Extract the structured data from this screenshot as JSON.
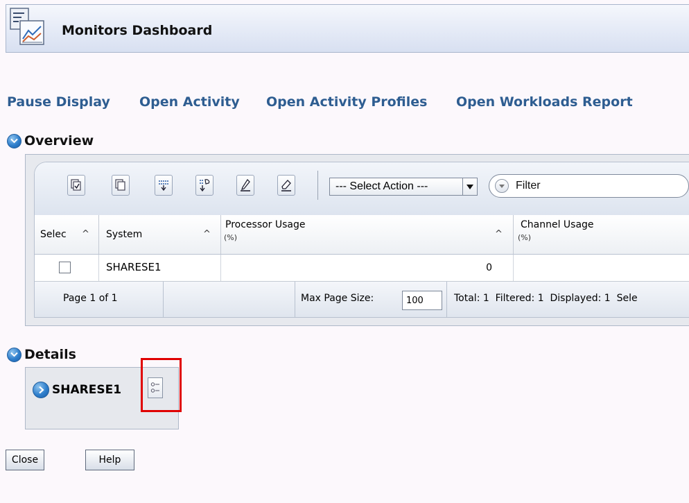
{
  "window": {
    "title": "Monitors Dashboard"
  },
  "links": {
    "pause_display": "Pause Display",
    "open_activity": "Open Activity",
    "open_activity_profiles": "Open Activity Profiles",
    "open_workloads_report": "Open Workloads Report"
  },
  "overview": {
    "title": "Overview",
    "toolbar": {
      "select_action": "--- Select Action ---",
      "filter_placeholder": "Filter"
    },
    "columns": {
      "select": {
        "label": "Selec",
        "sort": "^"
      },
      "system": {
        "label": "System",
        "sort": "^"
      },
      "processor": {
        "label": "Processor Usage",
        "unit": "(%)",
        "sort": "^"
      },
      "channel": {
        "label": "Channel Usage",
        "unit": "(%)"
      }
    },
    "rows": [
      {
        "system": "SHARESE1",
        "processor_usage": "0",
        "channel_usage": ""
      }
    ],
    "pager": {
      "page_info": "Page 1 of 1",
      "max_page_size_label": "Max Page Size:",
      "max_page_size_value": "100",
      "summary": "Total: 1  Filtered: 1  Displayed: 1  Sele"
    }
  },
  "details": {
    "title": "Details",
    "item_label": "SHARESE1"
  },
  "buttons": {
    "close": "Close",
    "help": "Help"
  },
  "colors": {
    "link": "#2e5d91",
    "toggle": "#2f7fcc",
    "highlight": "#e00000"
  }
}
